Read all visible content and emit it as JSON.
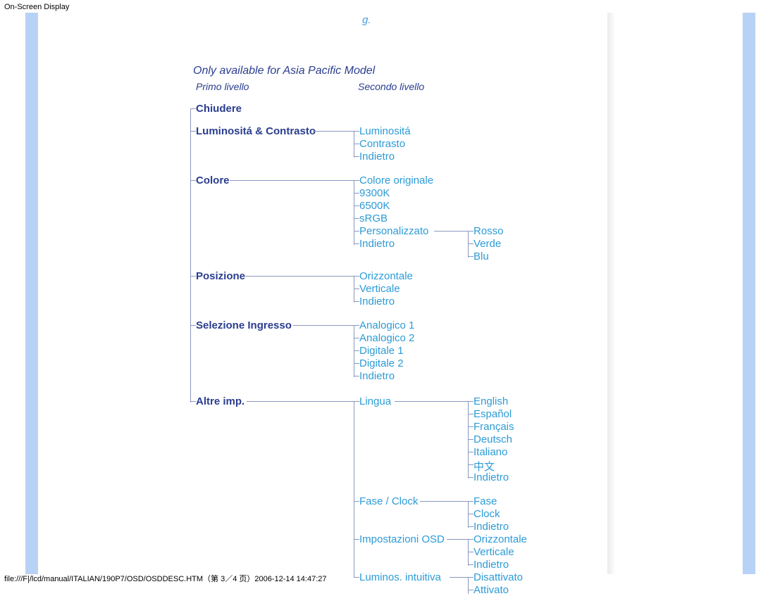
{
  "page_title": "On-Screen Display",
  "footer": "file:///F|/lcd/manual/ITALIAN/190P7/OSD/OSDDESC.HTM（第 3／4 页）2006-12-14 14:47:27",
  "clipped_top_fragment": "g.",
  "heading": "Only available for Asia Pacific Model",
  "sub1": "Primo livello",
  "sub2": "Secondo livello",
  "l1": {
    "chiudere": "Chiudere",
    "lumcon": "Luminositá & Contrasto",
    "colore": "Colore",
    "posizione": "Posizione",
    "selezione": "Selezione Ingresso",
    "altre": "Altre imp."
  },
  "l2": {
    "luminosita": "Luminositá",
    "contrasto": "Contrasto",
    "indietro1": "Indietro",
    "col_orig": "Colore originale",
    "k9300": "9300K",
    "k6500": "6500K",
    "srgb": "sRGB",
    "personal": "Personalizzato",
    "indietro2": "Indietro",
    "orizz": "Orizzontale",
    "vert": "Verticale",
    "indietro3": "Indietro",
    "ana1": "Analogico 1",
    "ana2": "Analogico 2",
    "dig1": "Digitale 1",
    "dig2": "Digitale 2",
    "indietro4": "Indietro",
    "lingua": "Lingua",
    "faseclock": "Fase / Clock",
    "imposd": "Impostazioni OSD",
    "lumint": "Luminos. intuitiva"
  },
  "l3": {
    "rosso": "Rosso",
    "verde": "Verde",
    "blu": "Blu",
    "english": "English",
    "espanol": "Español",
    "francais": "Français",
    "deutsch": "Deutsch",
    "italiano": "Italiano",
    "chinese": "中文",
    "indietro5": "Indietro",
    "fase": "Fase",
    "clock": "Clock",
    "indietro6": "Indietro",
    "orizz2": "Orizzontale",
    "vert2": "Verticale",
    "indietro7": "Indietro",
    "disatt": "Disattivato",
    "attiv": "Attivato"
  }
}
